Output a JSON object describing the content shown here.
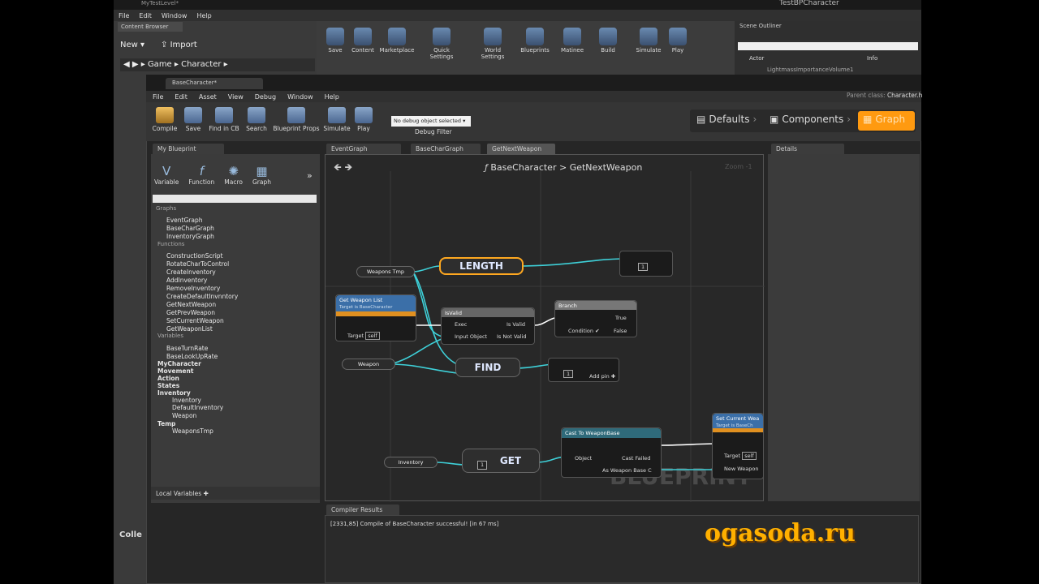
{
  "editor": {
    "level_title": "MyTestLevel*",
    "right_title": "TestBPCharacter"
  },
  "menu": [
    "File",
    "Edit",
    "Window",
    "Help"
  ],
  "content_browser": {
    "tab": "Content Browser",
    "new": "New",
    "import": "Import",
    "path": [
      "Game",
      "Character"
    ],
    "collections": "Colle"
  },
  "toolbar": [
    "Save",
    "Content",
    "Marketplace",
    "Quick Settings",
    "World Settings",
    "Blueprints",
    "Matinee",
    "Build",
    "Simulate",
    "Play"
  ],
  "outliner": {
    "tab": "Scene Outliner",
    "col_actor": "Actor",
    "col_info": "Info",
    "row": "LightmassImportanceVolume1"
  },
  "blueprint": {
    "tab": "BaseCharacter*",
    "menu": [
      "File",
      "Edit",
      "Asset",
      "View",
      "Debug",
      "Window",
      "Help"
    ],
    "parent_label": "Parent class:",
    "parent_value": "Character.h",
    "tools": [
      "Compile",
      "Save",
      "Find in CB",
      "Search",
      "Blueprint Props",
      "Simulate",
      "Play"
    ],
    "debug_select": "No debug object selected",
    "debug_filter": "Debug Filter",
    "modes": [
      "Defaults",
      "Components",
      "Graph"
    ]
  },
  "my_blueprint": {
    "tab": "My Blueprint",
    "add": [
      "Variable",
      "Function",
      "Macro",
      "Graph"
    ],
    "graphs_label": "Graphs",
    "graphs": [
      "EventGraph",
      "BaseCharGraph",
      "InventoryGraph"
    ],
    "functions_label": "Functions",
    "functions": [
      "ConstructionScript",
      "RotateCharToControl",
      "CreateInventory",
      "AddInventory",
      "RemoveInventory",
      "CreateDefaultInvnntory",
      "GetNextWeapon",
      "GetPrevWeapon",
      "SetCurrentWeapon",
      "GetWeaponList"
    ],
    "variables_label": "Variables",
    "variables": [
      "BaseTurnRate",
      "BaseLookUpRate"
    ],
    "categories": [
      "MyCharacter",
      "Movement",
      "Action",
      "States",
      "Inventory"
    ],
    "inventory_vars": [
      "Inventory",
      "DefaultInventory",
      "Weapon"
    ],
    "temp_label": "Temp",
    "temp_vars": [
      "WeaponsTmp"
    ],
    "local_vars": "Local Variables"
  },
  "graph_tabs": [
    "EventGraph",
    "BaseCharGraph",
    "GetNextWeapon"
  ],
  "graph": {
    "breadcrumb_root": "BaseCharacter",
    "breadcrumb_sep": ">",
    "breadcrumb_leaf": "GetNextWeapon",
    "zoom": "Zoom -1",
    "watermark": "BLUEPRINT",
    "nodes": {
      "weapons_tmp": "Weapons Tmp",
      "length": "LENGTH",
      "find": "FIND",
      "get": "GET",
      "weapon": "Weapon",
      "inventory": "Inventory",
      "get_weapon_list": "Get Weapon List",
      "target_is_base": "Target is BaseCharacter",
      "target": "Target",
      "self": "self",
      "is_valid": "IsValid",
      "exec": "Exec",
      "input_object": "Input Object",
      "is_valid_out": "Is Valid",
      "is_not_valid": "Is Not Valid",
      "branch": "Branch",
      "condition": "Condition",
      "true": "True",
      "false": "False",
      "add_pin": "Add pin",
      "one": "1",
      "cast": "Cast To WeaponBase",
      "object": "Object",
      "cast_failed": "Cast Failed",
      "as_weapon": "As Weapon Base C",
      "set_weapon": "Set Current Wea",
      "target_is_base2": "Target is BaseCh",
      "new_weapon": "New Weapon"
    }
  },
  "details_tab": "Details",
  "compiler": {
    "tab": "Compiler Results",
    "message": "[2331,85] Compile of BaseCharacter successful! [in 67 ms]"
  },
  "site": "ogasoda.ru"
}
